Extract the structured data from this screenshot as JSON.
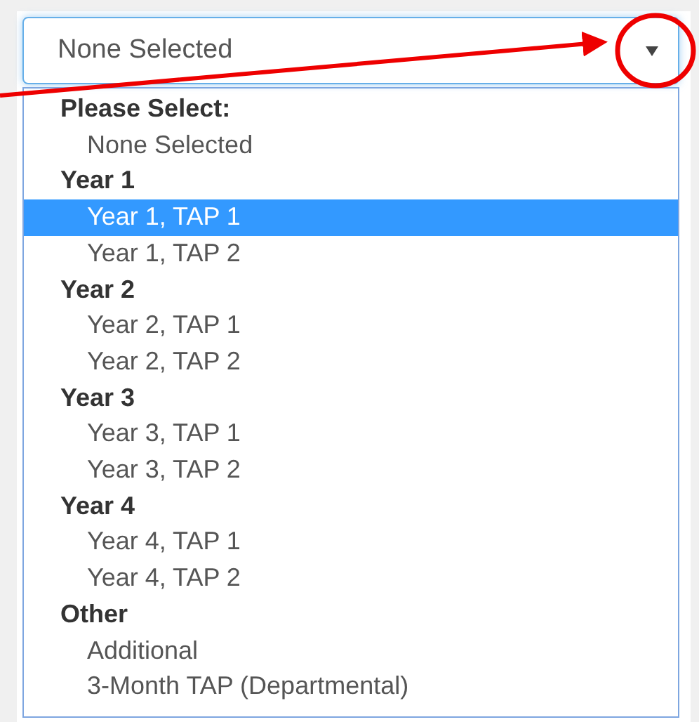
{
  "select": {
    "value": "None Selected",
    "expanded": true
  },
  "groups": [
    {
      "label": "Please Select:",
      "options": [
        {
          "label": "None Selected",
          "selected": false
        }
      ]
    },
    {
      "label": "Year 1",
      "options": [
        {
          "label": "Year 1, TAP 1",
          "selected": true
        },
        {
          "label": "Year 1, TAP 2",
          "selected": false
        }
      ]
    },
    {
      "label": "Year 2",
      "options": [
        {
          "label": "Year 2, TAP 1",
          "selected": false
        },
        {
          "label": "Year 2, TAP 2",
          "selected": false
        }
      ]
    },
    {
      "label": "Year 3",
      "options": [
        {
          "label": "Year 3, TAP 1",
          "selected": false
        },
        {
          "label": "Year 3, TAP 2",
          "selected": false
        }
      ]
    },
    {
      "label": "Year 4",
      "options": [
        {
          "label": "Year 4, TAP 1",
          "selected": false
        },
        {
          "label": "Year 4, TAP 2",
          "selected": false
        }
      ]
    },
    {
      "label": "Other",
      "options": [
        {
          "label": "Additional",
          "selected": false
        },
        {
          "label": "3-Month TAP (Departmental)",
          "selected": false
        }
      ]
    }
  ]
}
